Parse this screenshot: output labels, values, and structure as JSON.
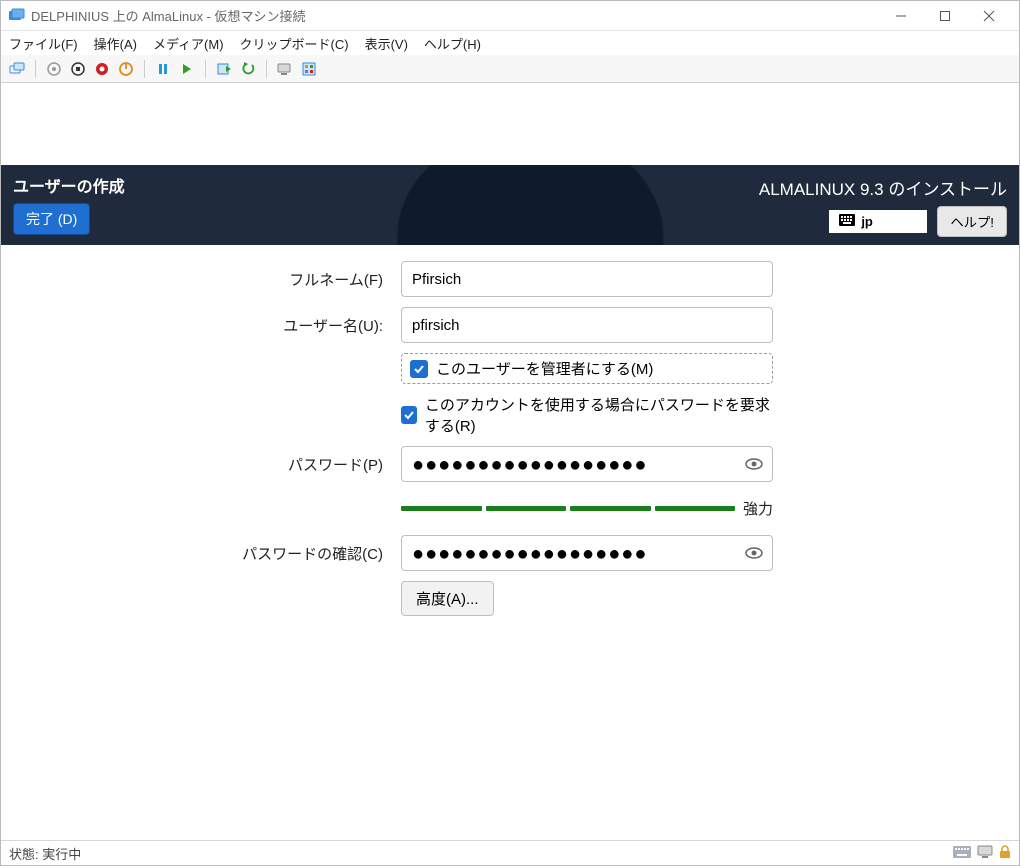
{
  "titlebar": {
    "title": "DELPHINIUS 上の AlmaLinux  - 仮想マシン接続"
  },
  "menubar": {
    "items": [
      "ファイル(F)",
      "操作(A)",
      "メディア(M)",
      "クリップボード(C)",
      "表示(V)",
      "ヘルプ(H)"
    ]
  },
  "toolbar_icons": {
    "ctrl_alt_del": "ctrl-alt-del",
    "start": "start",
    "turn_off": "turn-off",
    "shutdown": "shutdown",
    "save": "save",
    "pause": "pause",
    "reset": "reset",
    "checkpoint": "checkpoint",
    "revert": "revert",
    "enhanced": "enhanced",
    "share": "share"
  },
  "installer": {
    "page_title": "ユーザーの作成",
    "done_label": "完了 (D)",
    "install_title": "ALMALINUX 9.3 のインストール",
    "keyboard_layout": "jp",
    "help_label": "ヘルプ!"
  },
  "form": {
    "fullname_label": "フルネーム(F)",
    "fullname_value": "Pfirsich",
    "username_label": "ユーザー名(U):",
    "username_value": "pfirsich",
    "make_admin_label": "このユーザーを管理者にする(M)",
    "make_admin_checked": true,
    "require_pw_label": "このアカウントを使用する場合にパスワードを要求する(R)",
    "require_pw_checked": true,
    "password_label": "パスワード(P)",
    "password_value": "●●●●●●●●●●●●●●●●●●",
    "strength_label": "強力",
    "confirm_label": "パスワードの確認(C)",
    "confirm_value": "●●●●●●●●●●●●●●●●●●",
    "advanced_label": "高度(A)..."
  },
  "statusbar": {
    "status_text": "状態: 実行中"
  }
}
